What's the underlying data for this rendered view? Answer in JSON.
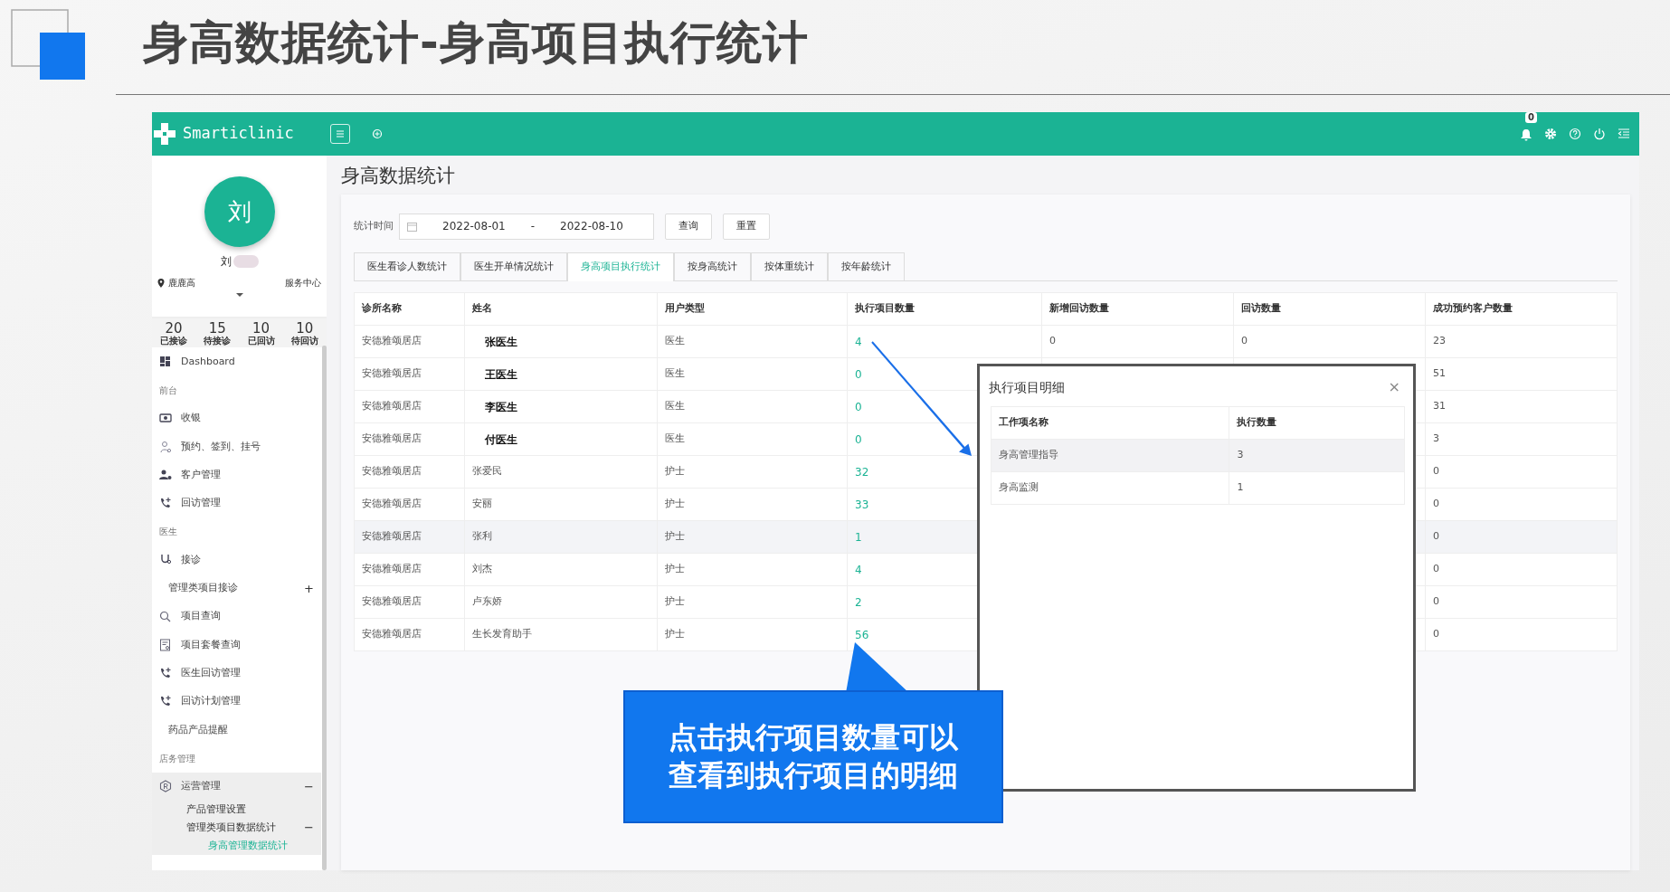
{
  "slide_title": "身高数据统计-身高项目执行统计",
  "app": {
    "brand": "Smarticlinic",
    "notification_count": "0"
  },
  "user": {
    "avatar": "刘",
    "name": "刘",
    "location": "鹿鹿高",
    "org": "服务中心"
  },
  "stats": [
    {
      "value": "20",
      "label": "已接诊"
    },
    {
      "value": "15",
      "label": "待接诊"
    },
    {
      "value": "10",
      "label": "已回访"
    },
    {
      "value": "10",
      "label": "待回访"
    }
  ],
  "sidebar": {
    "items": [
      {
        "kind": "link",
        "label": "Dashboard"
      },
      {
        "kind": "section",
        "label": "前台"
      },
      {
        "kind": "link",
        "label": "收银"
      },
      {
        "kind": "link",
        "label": "预约、签到、挂号"
      },
      {
        "kind": "link",
        "label": "客户管理"
      },
      {
        "kind": "link",
        "label": "回访管理"
      },
      {
        "kind": "section",
        "label": "医生"
      },
      {
        "kind": "link",
        "label": "接诊"
      },
      {
        "kind": "plain",
        "label": "管理类项目接诊",
        "expander": "+"
      },
      {
        "kind": "link",
        "label": "项目查询"
      },
      {
        "kind": "link",
        "label": "项目套餐查询"
      },
      {
        "kind": "link",
        "label": "医生回访管理"
      },
      {
        "kind": "link",
        "label": "回访计划管理"
      },
      {
        "kind": "plain",
        "label": "药品产品提醒"
      },
      {
        "kind": "section",
        "label": "店务管理"
      },
      {
        "kind": "link",
        "label": "运营管理",
        "expander": "−",
        "children": [
          {
            "label": "产品管理设置",
            "selected": false
          },
          {
            "label": "管理类项目数据统计",
            "expander": "−",
            "children": [
              {
                "label": "身高管理数据统计",
                "selected": true
              }
            ]
          }
        ]
      }
    ]
  },
  "page_title": "身高数据统计",
  "filter": {
    "label": "统计时间",
    "start": "2022-08-01",
    "separator": "-",
    "end": "2022-08-10",
    "buttons": [
      "查询",
      "重置"
    ]
  },
  "tabs": [
    {
      "label": "医生看诊人数统计",
      "selected": false
    },
    {
      "label": "医生开单情况统计",
      "selected": false
    },
    {
      "label": "身高项目执行统计",
      "selected": true
    },
    {
      "label": "按身高统计",
      "selected": false
    },
    {
      "label": "按体重统计",
      "selected": false
    },
    {
      "label": "按年龄统计",
      "selected": false
    }
  ],
  "table": {
    "columns": [
      "诊所名称",
      "姓名",
      "用户类型",
      "执行项目数量",
      "新增回访数量",
      "回访数量",
      "成功预约客户数量"
    ],
    "rows": [
      {
        "clinic": "安德雅颂居店",
        "name": "张医生",
        "name_bold": true,
        "user_type": "医生",
        "exec_count": "4",
        "new_visits": "0",
        "visits": "0",
        "success": "23",
        "highlighted": false
      },
      {
        "clinic": "安德雅颂居店",
        "name": "王医生",
        "name_bold": true,
        "user_type": "医生",
        "exec_count": "0",
        "success": "51",
        "highlighted": false
      },
      {
        "clinic": "安德雅颂居店",
        "name": "李医生",
        "name_bold": true,
        "user_type": "医生",
        "exec_count": "0",
        "success": "31",
        "highlighted": false
      },
      {
        "clinic": "安德雅颂居店",
        "name": "付医生",
        "name_bold": true,
        "user_type": "医生",
        "exec_count": "0",
        "success": "3",
        "highlighted": false
      },
      {
        "clinic": "安德雅颂居店",
        "name": "张爱民",
        "name_bold": false,
        "user_type": "护士",
        "exec_count": "32",
        "success": "0",
        "highlighted": false
      },
      {
        "clinic": "安德雅颂居店",
        "name": "安丽",
        "name_bold": false,
        "user_type": "护士",
        "exec_count": "33",
        "success": "0",
        "highlighted": false
      },
      {
        "clinic": "安德雅颂居店",
        "name": "张利",
        "name_bold": false,
        "user_type": "护士",
        "exec_count": "1",
        "success": "0",
        "highlighted": true
      },
      {
        "clinic": "安德雅颂居店",
        "name": "刘杰",
        "name_bold": false,
        "user_type": "护士",
        "exec_count": "4",
        "success": "0",
        "highlighted": false
      },
      {
        "clinic": "安德雅颂居店",
        "name": "卢东娇",
        "name_bold": false,
        "user_type": "护士",
        "exec_count": "2",
        "success": "0",
        "highlighted": false
      },
      {
        "clinic": "安德雅颂居店",
        "name": "生长发育助手",
        "name_bold": false,
        "user_type": "护士",
        "exec_count": "56",
        "success": "0",
        "highlighted": false
      }
    ]
  },
  "modal": {
    "title": "执行项目明细",
    "close": "×",
    "columns": [
      "工作项名称",
      "执行数量"
    ],
    "rows": [
      {
        "name": "身高管理指导",
        "count": "3",
        "highlighted": true
      },
      {
        "name": "身高监测",
        "count": "1",
        "highlighted": false
      }
    ]
  },
  "callout": {
    "lines": [
      "点击执行项目数量可以",
      "查看到执行项目的明细"
    ]
  }
}
